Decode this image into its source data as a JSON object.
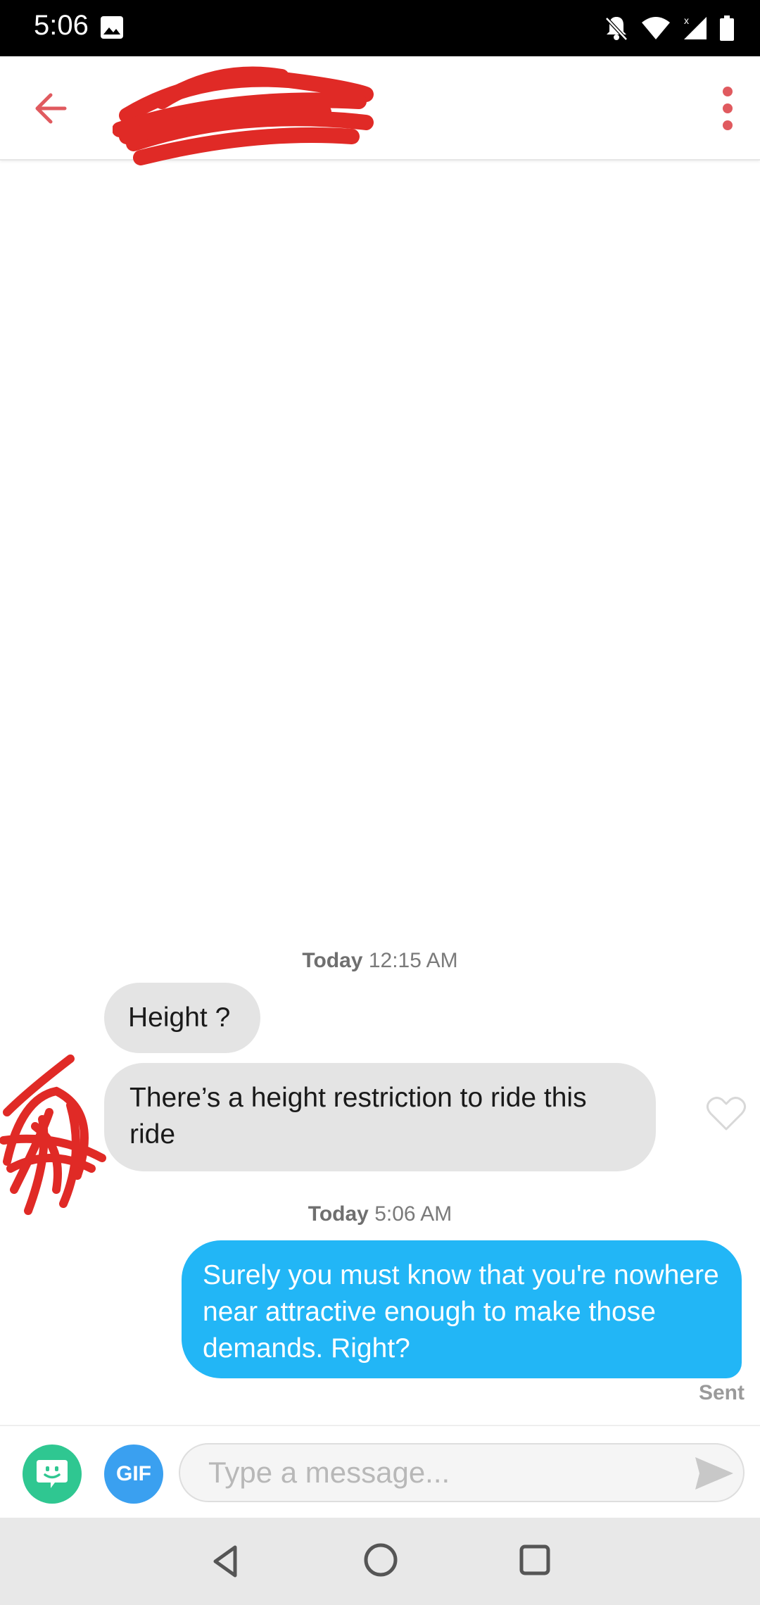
{
  "status_bar": {
    "time": "5:06"
  },
  "conversation": {
    "groups": [
      {
        "day": "Today",
        "time": "12:15 AM"
      },
      {
        "day": "Today",
        "time": "5:06 AM"
      }
    ],
    "received": [
      {
        "text": "Height ?"
      },
      {
        "text": "There’s a height restriction to ride this ride"
      }
    ],
    "sent": [
      {
        "text": "Surely you must know that you're nowhere near attractive enough to make those demands. Right?",
        "status": "Sent"
      }
    ]
  },
  "composer": {
    "gif_label": "GIF",
    "placeholder": "Type a message...",
    "value": ""
  },
  "colors": {
    "accent": "#e05a5f",
    "incoming_bubble": "#e4e4e4",
    "outgoing_bubble": "#22b6f6",
    "redaction": "#e02a26",
    "sticker_button": "#2fc791",
    "gif_button": "#3aa0f0"
  },
  "icons": {
    "back": "arrow-left-icon",
    "more": "more-vertical-icon",
    "like": "heart-outline-icon",
    "sticker": "sticker-icon",
    "send": "send-icon"
  }
}
